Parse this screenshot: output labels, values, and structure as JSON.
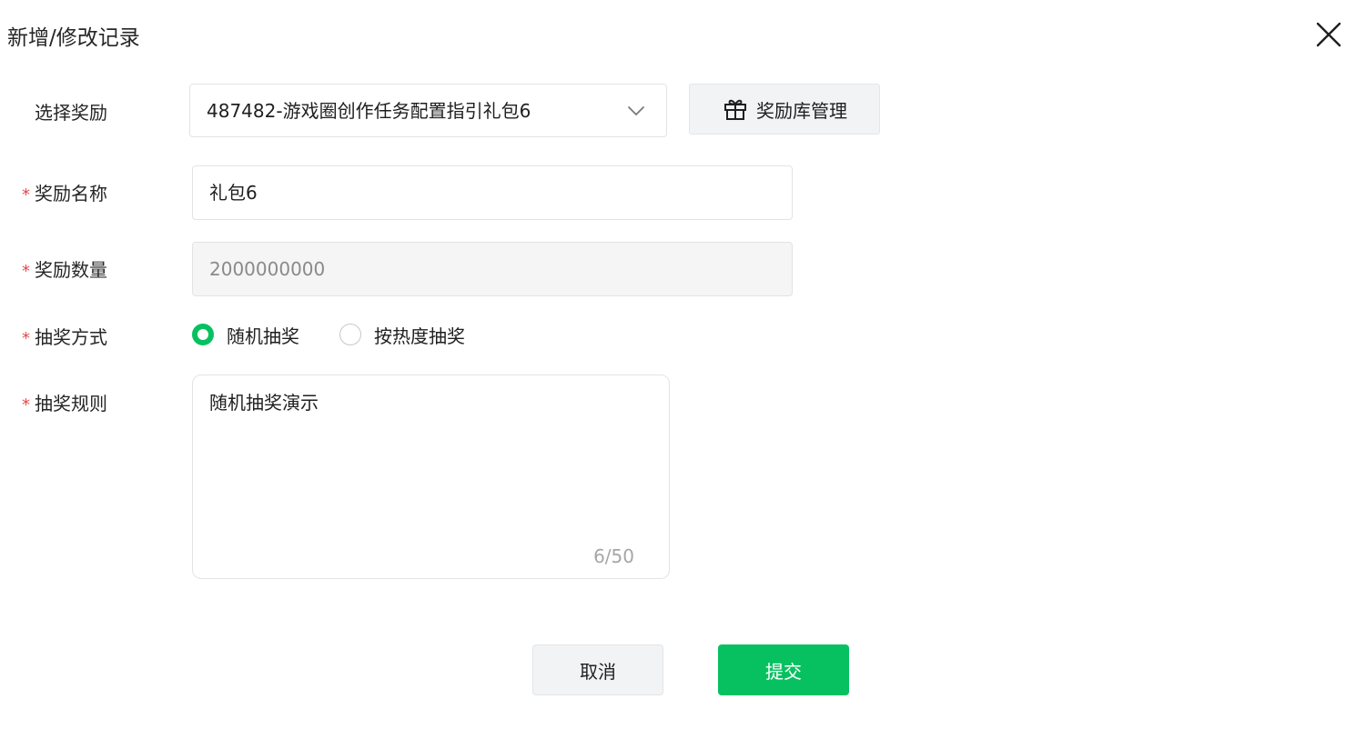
{
  "dialog": {
    "title": "新增/修改记录",
    "close_icon": "close-icon"
  },
  "form": {
    "reward_select": {
      "label": "选择奖励",
      "required": false,
      "value": "487482-游戏圈创作任务配置指引礼包6",
      "icon": "chevron-down-icon"
    },
    "library_button": {
      "label": "奖励库管理",
      "icon": "gift-icon"
    },
    "reward_name": {
      "label": "奖励名称",
      "required": true,
      "value": "礼包6"
    },
    "reward_count": {
      "label": "奖励数量",
      "required": true,
      "value": "2000000000",
      "disabled": true
    },
    "draw_method": {
      "label": "抽奖方式",
      "required": true,
      "options": [
        {
          "label": "随机抽奖",
          "checked": true
        },
        {
          "label": "按热度抽奖",
          "checked": false
        }
      ]
    },
    "draw_rules": {
      "label": "抽奖规则",
      "required": true,
      "value": "随机抽奖演示",
      "counter": "6/50"
    },
    "required_mark": "*"
  },
  "actions": {
    "cancel_label": "取消",
    "submit_label": "提交"
  },
  "colors": {
    "accent": "#07c160",
    "required": "#e5484d",
    "disabled_bg": "#f5f5f5"
  }
}
